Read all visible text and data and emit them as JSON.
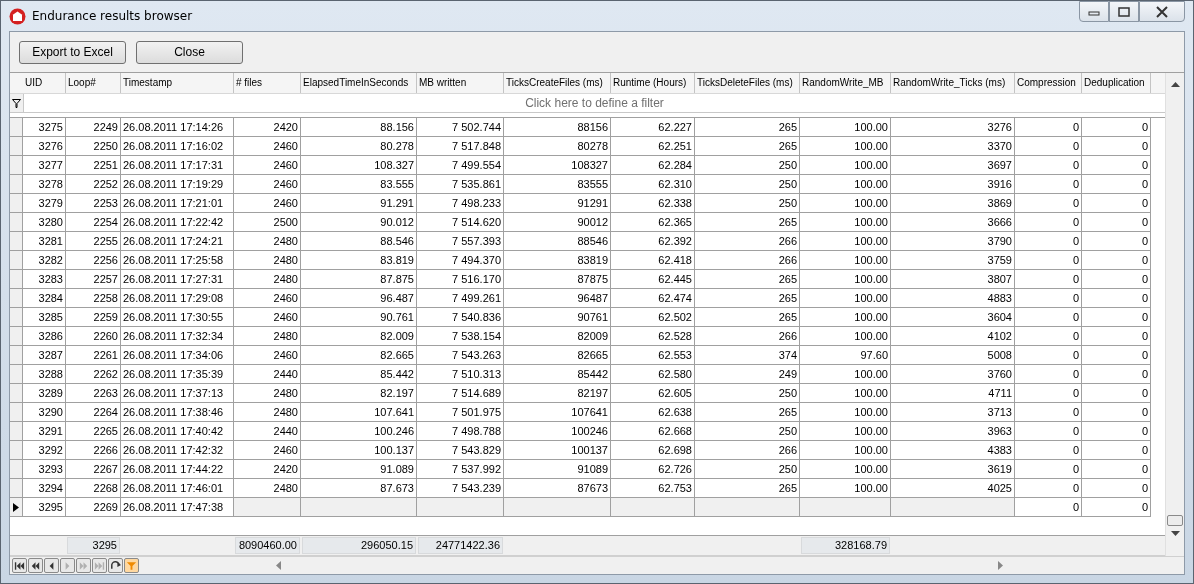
{
  "window": {
    "title": "Endurance results browser"
  },
  "toolbar": {
    "buttons": [
      "Export to Excel",
      "Close"
    ]
  },
  "table": {
    "columns": [
      {
        "label": "UID",
        "kind": "number"
      },
      {
        "label": "Loop#",
        "kind": "number"
      },
      {
        "label": "Timestamp",
        "kind": "text"
      },
      {
        "label": "# files",
        "kind": "number"
      },
      {
        "label": "ElapsedTimeInSeconds",
        "kind": "number"
      },
      {
        "label": "MB written",
        "kind": "number"
      },
      {
        "label": "TicksCreateFiles (ms)",
        "kind": "number"
      },
      {
        "label": "Runtime (Hours)",
        "kind": "number"
      },
      {
        "label": "TicksDeleteFiles (ms)",
        "kind": "number"
      },
      {
        "label": "RandomWrite_MB",
        "kind": "number"
      },
      {
        "label": "RandomWrite_Ticks (ms)",
        "kind": "number"
      },
      {
        "label": "Compression",
        "kind": "number"
      },
      {
        "label": "Deduplication",
        "kind": "number"
      }
    ],
    "filter_hint": "Click here to define a filter",
    "rows": [
      {
        "current": false,
        "cells": [
          "3275",
          "2249",
          "26.08.2011 17:14:26",
          "2420",
          "88.156",
          "7 502.744",
          "88156",
          "62.227",
          "265",
          "100.00",
          "3276",
          "0",
          "0"
        ]
      },
      {
        "current": false,
        "cells": [
          "3276",
          "2250",
          "26.08.2011 17:16:02",
          "2460",
          "80.278",
          "7 517.848",
          "80278",
          "62.251",
          "265",
          "100.00",
          "3370",
          "0",
          "0"
        ]
      },
      {
        "current": false,
        "cells": [
          "3277",
          "2251",
          "26.08.2011 17:17:31",
          "2460",
          "108.327",
          "7 499.554",
          "108327",
          "62.284",
          "250",
          "100.00",
          "3697",
          "0",
          "0"
        ]
      },
      {
        "current": false,
        "cells": [
          "3278",
          "2252",
          "26.08.2011 17:19:29",
          "2460",
          "83.555",
          "7 535.861",
          "83555",
          "62.310",
          "250",
          "100.00",
          "3916",
          "0",
          "0"
        ]
      },
      {
        "current": false,
        "cells": [
          "3279",
          "2253",
          "26.08.2011 17:21:01",
          "2460",
          "91.291",
          "7 498.233",
          "91291",
          "62.338",
          "250",
          "100.00",
          "3869",
          "0",
          "0"
        ]
      },
      {
        "current": false,
        "cells": [
          "3280",
          "2254",
          "26.08.2011 17:22:42",
          "2500",
          "90.012",
          "7 514.620",
          "90012",
          "62.365",
          "265",
          "100.00",
          "3666",
          "0",
          "0"
        ]
      },
      {
        "current": false,
        "cells": [
          "3281",
          "2255",
          "26.08.2011 17:24:21",
          "2480",
          "88.546",
          "7 557.393",
          "88546",
          "62.392",
          "266",
          "100.00",
          "3790",
          "0",
          "0"
        ]
      },
      {
        "current": false,
        "cells": [
          "3282",
          "2256",
          "26.08.2011 17:25:58",
          "2480",
          "83.819",
          "7 494.370",
          "83819",
          "62.418",
          "266",
          "100.00",
          "3759",
          "0",
          "0"
        ]
      },
      {
        "current": false,
        "cells": [
          "3283",
          "2257",
          "26.08.2011 17:27:31",
          "2480",
          "87.875",
          "7 516.170",
          "87875",
          "62.445",
          "265",
          "100.00",
          "3807",
          "0",
          "0"
        ]
      },
      {
        "current": false,
        "cells": [
          "3284",
          "2258",
          "26.08.2011 17:29:08",
          "2460",
          "96.487",
          "7 499.261",
          "96487",
          "62.474",
          "265",
          "100.00",
          "4883",
          "0",
          "0"
        ]
      },
      {
        "current": false,
        "cells": [
          "3285",
          "2259",
          "26.08.2011 17:30:55",
          "2460",
          "90.761",
          "7 540.836",
          "90761",
          "62.502",
          "265",
          "100.00",
          "3604",
          "0",
          "0"
        ]
      },
      {
        "current": false,
        "cells": [
          "3286",
          "2260",
          "26.08.2011 17:32:34",
          "2480",
          "82.009",
          "7 538.154",
          "82009",
          "62.528",
          "266",
          "100.00",
          "4102",
          "0",
          "0"
        ]
      },
      {
        "current": false,
        "cells": [
          "3287",
          "2261",
          "26.08.2011 17:34:06",
          "2460",
          "82.665",
          "7 543.263",
          "82665",
          "62.553",
          "374",
          "97.60",
          "5008",
          "0",
          "0"
        ]
      },
      {
        "current": false,
        "cells": [
          "3288",
          "2262",
          "26.08.2011 17:35:39",
          "2440",
          "85.442",
          "7 510.313",
          "85442",
          "62.580",
          "249",
          "100.00",
          "3760",
          "0",
          "0"
        ]
      },
      {
        "current": false,
        "cells": [
          "3289",
          "2263",
          "26.08.2011 17:37:13",
          "2480",
          "82.197",
          "7 514.689",
          "82197",
          "62.605",
          "250",
          "100.00",
          "4711",
          "0",
          "0"
        ]
      },
      {
        "current": false,
        "cells": [
          "3290",
          "2264",
          "26.08.2011 17:38:46",
          "2480",
          "107.641",
          "7 501.975",
          "107641",
          "62.638",
          "265",
          "100.00",
          "3713",
          "0",
          "0"
        ]
      },
      {
        "current": false,
        "cells": [
          "3291",
          "2265",
          "26.08.2011 17:40:42",
          "2440",
          "100.246",
          "7 498.788",
          "100246",
          "62.668",
          "250",
          "100.00",
          "3963",
          "0",
          "0"
        ]
      },
      {
        "current": false,
        "cells": [
          "3292",
          "2266",
          "26.08.2011 17:42:32",
          "2460",
          "100.137",
          "7 543.829",
          "100137",
          "62.698",
          "266",
          "100.00",
          "4383",
          "0",
          "0"
        ]
      },
      {
        "current": false,
        "cells": [
          "3293",
          "2267",
          "26.08.2011 17:44:22",
          "2420",
          "91.089",
          "7 537.992",
          "91089",
          "62.726",
          "250",
          "100.00",
          "3619",
          "0",
          "0"
        ]
      },
      {
        "current": false,
        "cells": [
          "3294",
          "2268",
          "26.08.2011 17:46:01",
          "2480",
          "87.673",
          "7 543.239",
          "87673",
          "62.753",
          "265",
          "100.00",
          "4025",
          "0",
          "0"
        ]
      },
      {
        "current": true,
        "cells": [
          "3295",
          "2269",
          "26.08.2011 17:47:38",
          null,
          null,
          null,
          null,
          null,
          null,
          null,
          null,
          "0",
          "0"
        ]
      }
    ],
    "summary": [
      {
        "kind": "none"
      },
      {
        "kind": "total",
        "value": "3295"
      },
      {
        "kind": "none"
      },
      {
        "kind": "total",
        "value": "8090460.00"
      },
      {
        "kind": "total",
        "value": "296050.15"
      },
      {
        "kind": "total",
        "value": "24771422.36"
      },
      {
        "kind": "none"
      },
      {
        "kind": "none"
      },
      {
        "kind": "none"
      },
      {
        "kind": "total",
        "value": "328168.79"
      },
      {
        "kind": "none"
      },
      {
        "kind": "none"
      },
      {
        "kind": "none"
      }
    ]
  },
  "navigator": [
    {
      "kind": "first",
      "disabled": false
    },
    {
      "kind": "prior-page",
      "disabled": false
    },
    {
      "kind": "prior",
      "disabled": false
    },
    {
      "kind": "next",
      "disabled": true
    },
    {
      "kind": "next-page",
      "disabled": true
    },
    {
      "kind": "last",
      "disabled": true
    },
    {
      "kind": "refresh",
      "disabled": false
    },
    {
      "kind": "filter",
      "disabled": false
    }
  ]
}
